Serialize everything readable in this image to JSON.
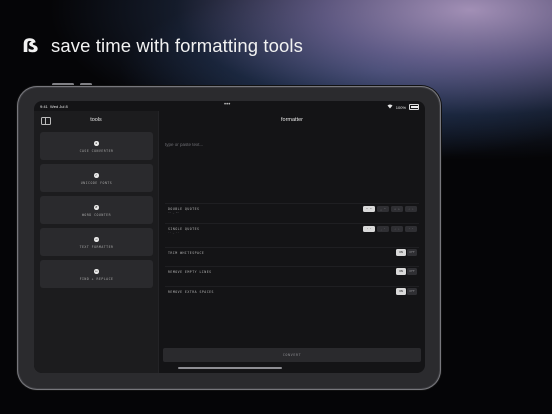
{
  "headline": {
    "logo": "ẞ",
    "text": "save time with formatting tools"
  },
  "statusbar": {
    "time": "9:41",
    "date": "Wed Jul 8",
    "battery": "100%"
  },
  "sidebar": {
    "title": "tools",
    "items": [
      {
        "icon": "case-icon",
        "glyph": "a",
        "label": "CASE CONVERTER"
      },
      {
        "icon": "unicode-icon",
        "glyph": "✓",
        "label": "UNICODE FONTS"
      },
      {
        "icon": "counter-icon",
        "glyph": "#",
        "label": "WORD COUNTER"
      },
      {
        "icon": "format-icon",
        "glyph": "→",
        "label": "TEXT FORMATTER"
      },
      {
        "icon": "replace-icon",
        "glyph": "↔",
        "label": "FIND + REPLACE"
      }
    ]
  },
  "main": {
    "title": "formatter",
    "input": {
      "placeholder": "type or paste text..."
    },
    "options": [
      {
        "label": "DOUBLE QUOTES",
        "sub": "\"\" → “”",
        "type": "segments",
        "choices": [
          "\" \"",
          "„ “",
          "« »",
          "‹ ›"
        ],
        "selected": 0
      },
      {
        "label": "SINGLE QUOTES",
        "sub": "'' → ‘’",
        "type": "segments",
        "choices": [
          "' '",
          "‚ ‘",
          "‹ ›",
          "‘ ’"
        ],
        "selected": 0
      },
      {
        "label": "TRIM WHITESPACE",
        "type": "toggle",
        "on": "ON",
        "off": "OFF",
        "state": "ON"
      },
      {
        "label": "REMOVE EMPTY LINES",
        "type": "toggle",
        "on": "ON",
        "off": "OFF",
        "state": "ON"
      },
      {
        "label": "REMOVE EXTRA SPACES",
        "type": "toggle",
        "on": "ON",
        "off": "OFF",
        "state": "ON"
      }
    ],
    "convert_label": "CONVERT"
  }
}
